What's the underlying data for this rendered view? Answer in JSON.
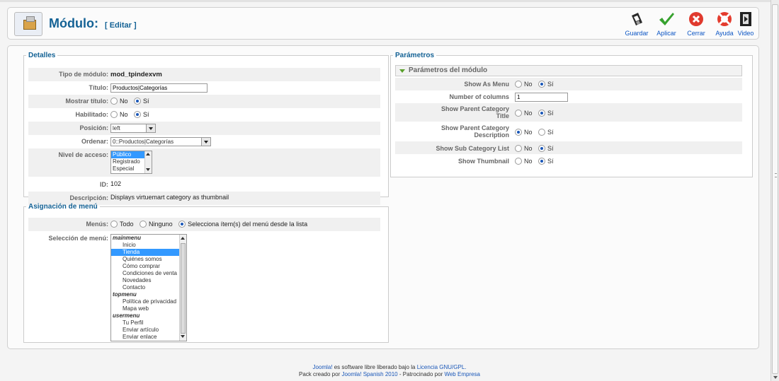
{
  "header": {
    "title": "Módulo:",
    "subtitle": "[ Editar ]",
    "buttons": [
      "Guardar",
      "Aplicar",
      "Cerrar",
      "Ayuda",
      "Video"
    ]
  },
  "details": {
    "legend": "Detalles",
    "module_type_label": "Tipo de módulo:",
    "module_type_value": "mod_tpindexvm",
    "title_label": "Título:",
    "title_value": "Productos|Categorías",
    "show_title_label": "Mostrar título:",
    "enabled_label": "Habilitado:",
    "no": "No",
    "si": "Sí",
    "position_label": "Posición:",
    "position_value": "left",
    "order_label": "Ordenar:",
    "order_value": "0::Productos|Categorías",
    "access_label": "Nivel de acceso:",
    "access_options": [
      "Público",
      "Registrado",
      "Especial"
    ],
    "id_label": "ID:",
    "id_value": "102",
    "desc_label": "Descripción:",
    "desc_value": "Displays virtuemart category as thumbnail"
  },
  "menu_assign": {
    "legend": "Asignación de menú",
    "menus_label": "Menús:",
    "opt_all": "Todo",
    "opt_none": "Ninguno",
    "opt_select": "Selecciona ítem(s) del menú desde la lista",
    "selection_label": "Selección de menú:",
    "items": [
      {
        "t": "mainmenu",
        "g": true
      },
      {
        "t": "Inicio"
      },
      {
        "t": "Tienda",
        "sel": true
      },
      {
        "t": "Quiénes somos"
      },
      {
        "t": "Cómo comprar"
      },
      {
        "t": "Condiciones de venta"
      },
      {
        "t": "Novedades"
      },
      {
        "t": "Contacto"
      },
      {
        "t": "topmenu",
        "g": true
      },
      {
        "t": "Política de privacidad"
      },
      {
        "t": "Mapa web"
      },
      {
        "t": "usermenu",
        "g": true
      },
      {
        "t": "Tu Perfil"
      },
      {
        "t": "Enviar artículo"
      },
      {
        "t": "Enviar enlace"
      }
    ]
  },
  "params": {
    "legend": "Parámetros",
    "section_title": "Parámetros del módulo",
    "show_as_menu": "Show As Menu",
    "num_columns": "Number of columns",
    "num_columns_value": "1",
    "show_parent_title": "Show Parent Category Title",
    "show_parent_desc": "Show Parent Category Description",
    "show_sub_list": "Show Sub Category List",
    "show_thumbnail": "Show Thumbnail",
    "no": "No",
    "si": "Sí"
  },
  "footer": {
    "l1a": "Joomla!",
    "l1b": " es software libre liberado bajo la ",
    "l1c": "Licencia GNU/GPL.",
    "l2a": "Pack creado por ",
    "l2b": "Joomla! Spanish 2010",
    "l2c": " - Patrocinado por ",
    "l2d": "Web Empresa"
  }
}
